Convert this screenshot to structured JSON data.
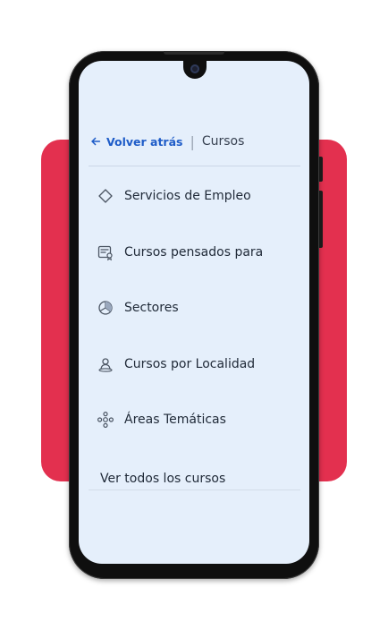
{
  "colors": {
    "accent_red": "#e3304f",
    "screen_bg": "#e5effb",
    "link_blue": "#1e5cc8",
    "text_dark": "#1f2937"
  },
  "breadcrumb": {
    "back_label": "Volver atrás",
    "separator": "|",
    "current": "Cursos"
  },
  "menu": {
    "items": [
      {
        "label": "Servicios de Empleo",
        "icon": "diamond-icon"
      },
      {
        "label": "Cursos pensados para",
        "icon": "certificate-icon"
      },
      {
        "label": "Sectores",
        "icon": "pie-chart-icon"
      },
      {
        "label": "Cursos por Localidad",
        "icon": "location-person-icon"
      },
      {
        "label": "Áreas Temáticas",
        "icon": "network-icon"
      }
    ],
    "view_all": "Ver todos los cursos"
  }
}
